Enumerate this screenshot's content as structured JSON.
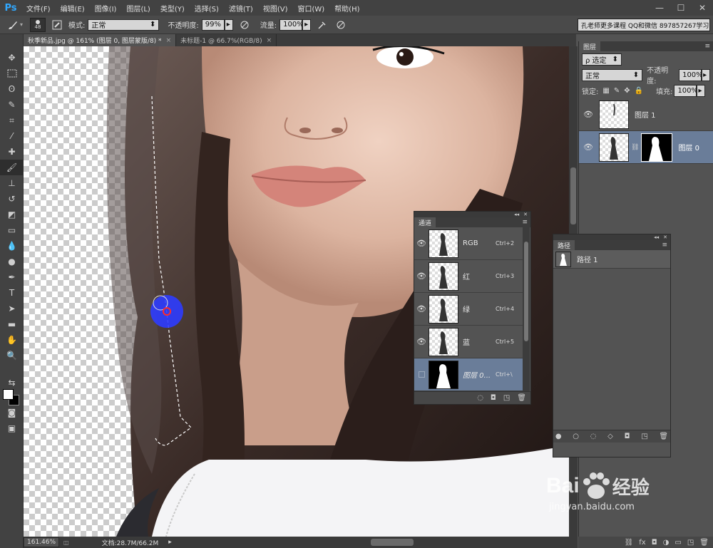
{
  "app": {
    "logo": "Ps"
  },
  "menu": [
    "文件(F)",
    "编辑(E)",
    "图像(I)",
    "图层(L)",
    "类型(Y)",
    "选择(S)",
    "滤镜(T)",
    "视图(V)",
    "窗口(W)",
    "帮助(H)"
  ],
  "window_controls": {
    "min": "—",
    "max": "☐",
    "close": "✕"
  },
  "options": {
    "brush_size": "48",
    "mode_label": "模式:",
    "mode_value": "正常",
    "opacity_label": "不透明度:",
    "opacity_value": "99%",
    "flow_label": "流量:",
    "flow_value": "100%",
    "workspace": "孔老师更多课程 QQ和微信 897857267学习"
  },
  "tabs": [
    {
      "label": "秋季新品.jpg @ 161% (图层 0, 图层蒙版/8) *",
      "close": "×"
    },
    {
      "label": "未标题-1 @ 66.7%(RGB/8)",
      "close": "×"
    }
  ],
  "status": {
    "zoom": "161.46%",
    "doc": "文档:28.7M/66.2M"
  },
  "layers_panel": {
    "tab": "图层",
    "filter": "ρ 选定",
    "blend": "正常",
    "opacity_label": "不透明度:",
    "opacity_value": "100%",
    "lock_label": "锁定:",
    "fill_label": "填充:",
    "fill_value": "100%",
    "layers": [
      {
        "name": "图层 1",
        "selected": false
      },
      {
        "name": "图层 0",
        "selected": true
      }
    ]
  },
  "channels_panel": {
    "tab": "通道",
    "channels": [
      {
        "name": "RGB",
        "key": "Ctrl+2",
        "selected": false
      },
      {
        "name": "红",
        "key": "Ctrl+3",
        "selected": false
      },
      {
        "name": "绿",
        "key": "Ctrl+4",
        "selected": false
      },
      {
        "name": "蓝",
        "key": "Ctrl+5",
        "selected": false
      },
      {
        "name": "图层 0...",
        "key": "Ctrl+\\",
        "selected": true
      }
    ]
  },
  "paths_panel": {
    "tab": "路径",
    "paths": [
      {
        "name": "路径 1"
      }
    ]
  },
  "watermark": {
    "brand": "Bai",
    "brand2": "经验",
    "url": "jingyan.baidu.com"
  }
}
